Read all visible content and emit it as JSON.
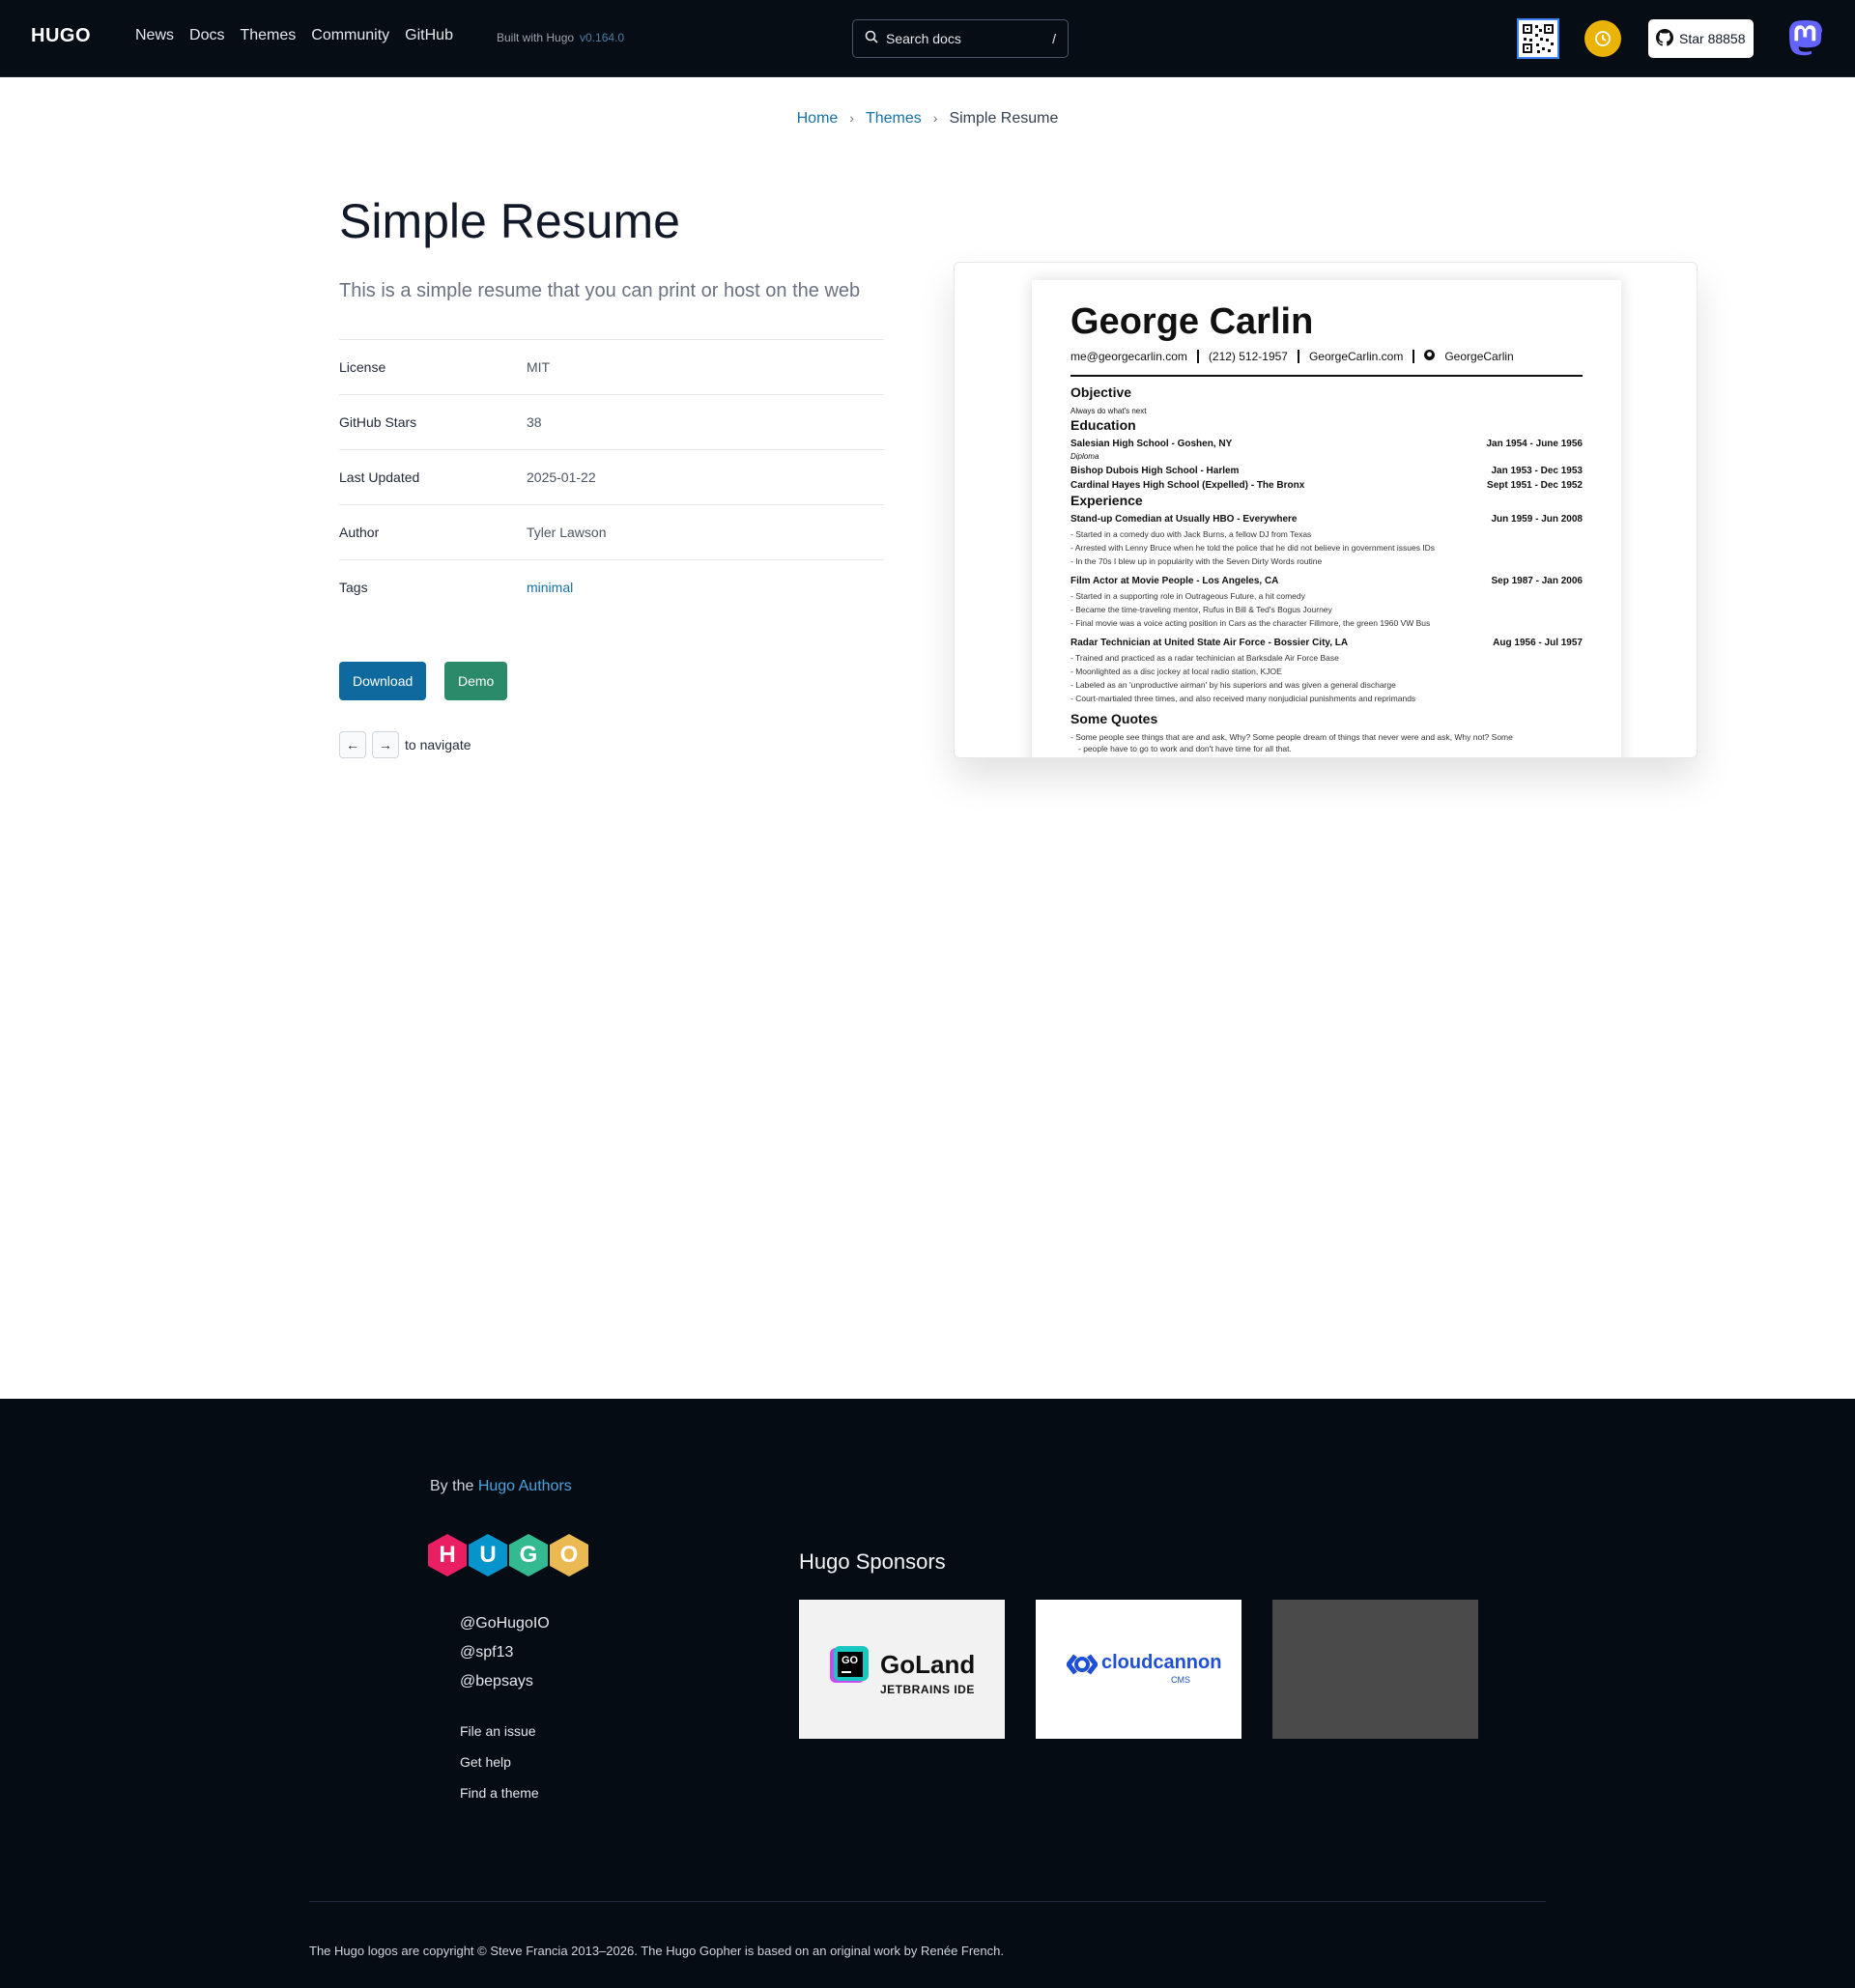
{
  "header": {
    "logo": "HUGO",
    "nav": [
      "News",
      "Docs",
      "Themes",
      "Community",
      "GitHub"
    ],
    "built_with": "Built with Hugo",
    "version": "v0.164.0",
    "search_placeholder": "Search docs",
    "search_shortcut": "/",
    "star_label": "Star 88858"
  },
  "breadcrumb": {
    "home": "Home",
    "themes": "Themes",
    "current": "Simple Resume",
    "sep": "›"
  },
  "theme": {
    "title": "Simple Resume",
    "description": "This is a simple resume that you can print or host on the web",
    "meta": [
      {
        "key": "License",
        "value": "MIT"
      },
      {
        "key": "GitHub Stars",
        "value": "38"
      },
      {
        "key": "Last Updated",
        "value": "2025-01-22"
      },
      {
        "key": "Author",
        "value": "Tyler Lawson"
      },
      {
        "key": "Tags",
        "value": "minimal"
      }
    ],
    "download_label": "Download",
    "demo_label": "Demo",
    "prev_key": "←",
    "next_key": "→",
    "navigate_text": "to navigate"
  },
  "preview": {
    "name": "George Carlin",
    "contact": [
      "me@georgecarlin.com",
      "(212) 512-1957",
      "GeorgeCarlin.com",
      "GeorgeCarlin"
    ],
    "objective_title": "Objective",
    "objective_text": "Always do what's next",
    "education_title": "Education",
    "education": [
      {
        "school": "Salesian High School - Goshen, NY",
        "dates": "Jan 1954 - June 1956",
        "note": "Diploma"
      },
      {
        "school": "Bishop Dubois High School - Harlem",
        "dates": "Jan 1953 - Dec 1953"
      },
      {
        "school": "Cardinal Hayes High School (Expelled) - The Bronx",
        "dates": "Sept 1951 - Dec 1952"
      }
    ],
    "experience_title": "Experience",
    "experience": [
      {
        "role": "Stand-up Comedian at Usually HBO - Everywhere",
        "dates": "Jun 1959 - Jun 2008",
        "bullets": [
          "Started in a comedy duo with Jack Burns, a fellow DJ from Texas",
          "Arrested with Lenny Bruce when he told the police that he did not believe in government issues IDs",
          "In the 70s I blew up in popularity with the Seven Dirty Words routine"
        ]
      },
      {
        "role": "Film Actor at Movie People - Los Angeles, CA",
        "dates": "Sep 1987 - Jan 2006",
        "bullets": [
          "Started in a supporting role in Outrageous Future, a hit comedy",
          "Became the time-traveling mentor, Rufus in Bill & Ted's Bogus Journey",
          "Final movie was a voice acting position in Cars as the character Fillmore, the green 1960 VW Bus"
        ]
      },
      {
        "role": "Radar Technician at United State Air Force - Bossier City, LA",
        "dates": "Aug 1956 - Jul 1957",
        "bullets": [
          "Trained and practiced as a radar techinician at Barksdale Air Force Base",
          "Moonlighted as a disc jockey at local radio station, KJOE",
          "Labeled as an 'unproductive airman' by his superiors and was given a general discharge",
          "Court-martialed three times, and also received many nonjudicial punishments and reprimands"
        ]
      }
    ],
    "quotes_title": "Some Quotes",
    "quote_1": "Some people see things that are and ask, Why? Some people dream of things that never were and ask, Why not? Some",
    "quote_2": "people have to go to work and don't have time for all that."
  },
  "footer": {
    "by_text": "By the",
    "by_link": "Hugo Authors",
    "logo_letters": [
      "H",
      "U",
      "G",
      "O"
    ],
    "logo_colors": [
      "#e91e63",
      "#0594cb",
      "#33ba91",
      "#ebb951"
    ],
    "social": [
      "@GoHugoIO",
      "@spf13",
      "@bepsays"
    ],
    "links": [
      "File an issue",
      "Get help",
      "Find a theme"
    ],
    "sponsors_title": "Hugo Sponsors",
    "goland_name": "GoLand",
    "goland_sub": "JETBRAINS IDE",
    "goland_badge": "GO",
    "cloudcannon_name": "cloudcannon",
    "cloudcannon_sub": "CMS",
    "copyright": "The Hugo logos are copyright © Steve Francia 2013–2026. The Hugo Gopher is based on an original work by Renée French."
  }
}
